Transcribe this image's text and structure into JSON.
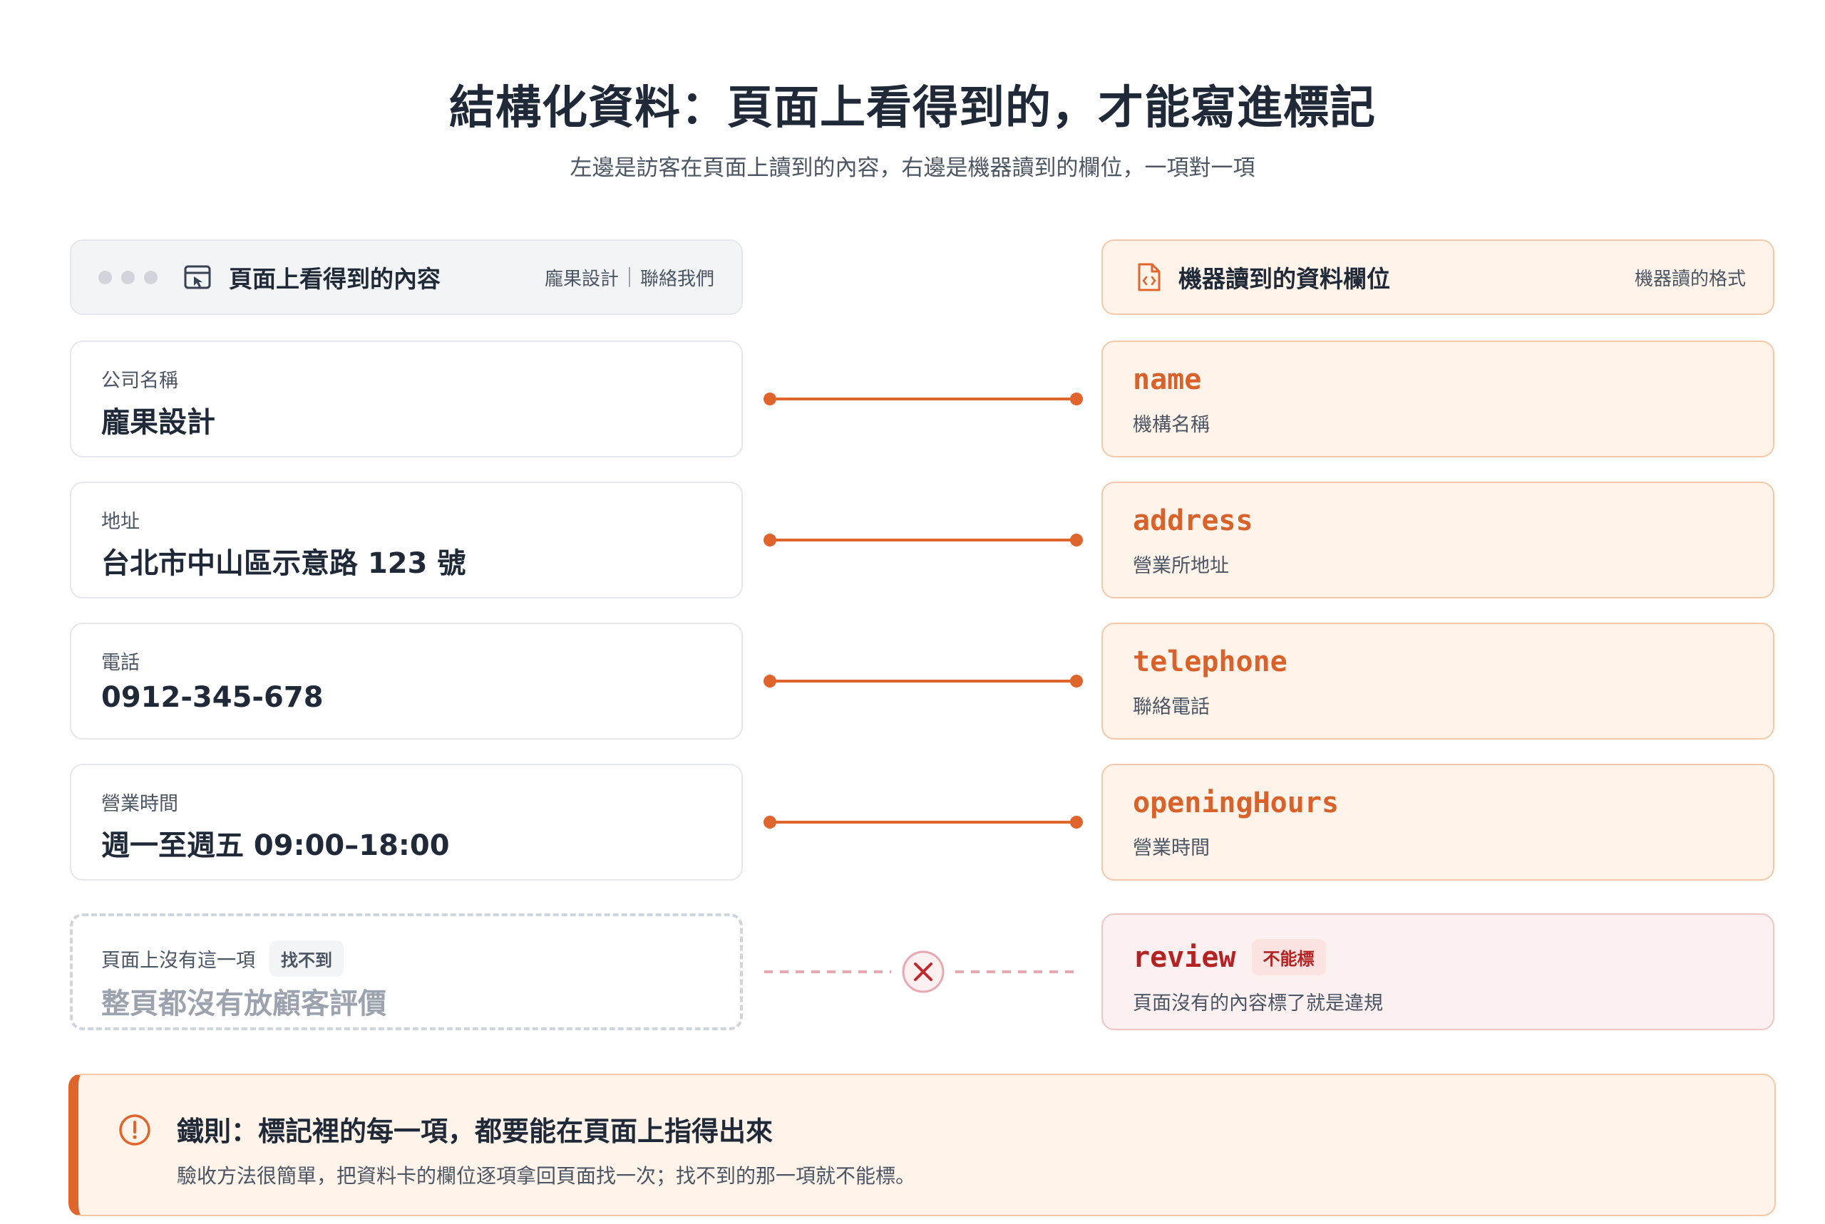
{
  "title": "結構化資料：頁面上看得到的，才能寫進標記",
  "subtitle": "左邊是訪客在頁面上讀到的內容，右邊是機器讀到的欄位，一項對一項",
  "left_header": {
    "title": "頁面上看得到的內容",
    "meta_brand": "龐果設計",
    "meta_contact": "聯絡我們"
  },
  "right_header": {
    "title": "機器讀到的資料欄位",
    "meta": "機器讀的格式"
  },
  "rows": [
    {
      "label": "公司名稱",
      "value": "龐果設計",
      "key": "name",
      "key_desc": "機構名稱"
    },
    {
      "label": "地址",
      "value": "台北市中山區示意路 123 號",
      "key": "address",
      "key_desc": "營業所地址"
    },
    {
      "label": "電話",
      "value": "0912-345-678",
      "key": "telephone",
      "key_desc": "聯絡電話"
    },
    {
      "label": "營業時間",
      "value": "週一至週五 09:00–18:00",
      "key": "openingHours",
      "key_desc": "營業時間"
    }
  ],
  "missing": {
    "label": "頁面上沒有這一項",
    "badge": "找不到",
    "value": "整頁都沒有放顧客評價",
    "key": "review",
    "key_badge": "不能標",
    "key_desc": "頁面沒有的內容標了就是違規"
  },
  "rule": {
    "title": "鐵則：標記裡的每一項，都要能在頁面上指得出來",
    "body": "驗收方法很簡單，把資料卡的欄位逐項拿回頁面找一次；找不到的那一項就不能標。"
  },
  "colors": {
    "accent": "#e0652d",
    "key_text": "#d9622b",
    "error": "#b42323",
    "dashed_line": "#e8a8b0"
  }
}
